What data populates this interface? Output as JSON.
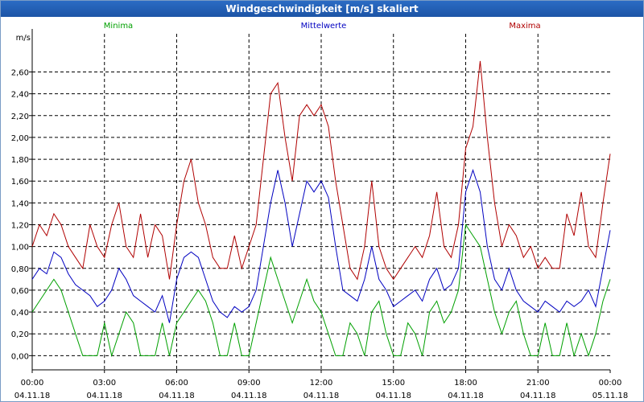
{
  "window": {
    "title": "Windgeschwindigkeit [m/s] skaliert"
  },
  "chart_data": {
    "type": "line",
    "title": "Windgeschwindigkeit [m/s] skaliert",
    "ylabel": "m/s",
    "xlabel": "",
    "ylim": [
      -0.13,
      2.95
    ],
    "xlim": [
      0,
      24
    ],
    "grid": true,
    "legend_position": "top",
    "y_ticks": [
      "0,00",
      "0,20",
      "0,40",
      "0,60",
      "0,80",
      "1,00",
      "1,20",
      "1,40",
      "1,60",
      "1,80",
      "2,00",
      "2,20",
      "2,40",
      "2,60"
    ],
    "x_ticks": [
      {
        "time": "00:00",
        "date": "04.11.18"
      },
      {
        "time": "03:00",
        "date": "04.11.18"
      },
      {
        "time": "06:00",
        "date": "04.11.18"
      },
      {
        "time": "09:00",
        "date": "04.11.18"
      },
      {
        "time": "12:00",
        "date": "04.11.18"
      },
      {
        "time": "15:00",
        "date": "04.11.18"
      },
      {
        "time": "18:00",
        "date": "04.11.18"
      },
      {
        "time": "21:00",
        "date": "04.11.18"
      },
      {
        "time": "00:00",
        "date": "05.11.18"
      }
    ],
    "series": [
      {
        "name": "Minima",
        "color": "#00a000",
        "points": [
          [
            0,
            0.4
          ],
          [
            0.3,
            0.5
          ],
          [
            0.6,
            0.6
          ],
          [
            0.9,
            0.7
          ],
          [
            1.2,
            0.6
          ],
          [
            1.5,
            0.4
          ],
          [
            1.8,
            0.2
          ],
          [
            2.1,
            0.0
          ],
          [
            2.4,
            0.0
          ],
          [
            2.7,
            0.0
          ],
          [
            3.0,
            0.3
          ],
          [
            3.3,
            0.0
          ],
          [
            3.6,
            0.2
          ],
          [
            3.9,
            0.4
          ],
          [
            4.2,
            0.3
          ],
          [
            4.5,
            0.0
          ],
          [
            4.8,
            0.0
          ],
          [
            5.1,
            0.0
          ],
          [
            5.4,
            0.3
          ],
          [
            5.7,
            0.0
          ],
          [
            6.0,
            0.3
          ],
          [
            6.3,
            0.4
          ],
          [
            6.6,
            0.5
          ],
          [
            6.9,
            0.6
          ],
          [
            7.2,
            0.5
          ],
          [
            7.5,
            0.3
          ],
          [
            7.8,
            0.0
          ],
          [
            8.1,
            0.0
          ],
          [
            8.4,
            0.3
          ],
          [
            8.7,
            0.0
          ],
          [
            9.0,
            0.0
          ],
          [
            9.3,
            0.3
          ],
          [
            9.6,
            0.6
          ],
          [
            9.9,
            0.9
          ],
          [
            10.2,
            0.7
          ],
          [
            10.5,
            0.5
          ],
          [
            10.8,
            0.3
          ],
          [
            11.1,
            0.5
          ],
          [
            11.4,
            0.7
          ],
          [
            11.7,
            0.5
          ],
          [
            12.0,
            0.4
          ],
          [
            12.3,
            0.2
          ],
          [
            12.6,
            0.0
          ],
          [
            12.9,
            0.0
          ],
          [
            13.2,
            0.3
          ],
          [
            13.5,
            0.2
          ],
          [
            13.8,
            0.0
          ],
          [
            14.1,
            0.4
          ],
          [
            14.4,
            0.5
          ],
          [
            14.7,
            0.2
          ],
          [
            15.0,
            0.0
          ],
          [
            15.3,
            0.0
          ],
          [
            15.6,
            0.3
          ],
          [
            15.9,
            0.2
          ],
          [
            16.2,
            0.0
          ],
          [
            16.5,
            0.4
          ],
          [
            16.8,
            0.5
          ],
          [
            17.1,
            0.3
          ],
          [
            17.4,
            0.4
          ],
          [
            17.7,
            0.6
          ],
          [
            18.0,
            1.2
          ],
          [
            18.3,
            1.1
          ],
          [
            18.6,
            1.0
          ],
          [
            18.9,
            0.7
          ],
          [
            19.2,
            0.4
          ],
          [
            19.5,
            0.2
          ],
          [
            19.8,
            0.4
          ],
          [
            20.1,
            0.5
          ],
          [
            20.4,
            0.2
          ],
          [
            20.7,
            0.0
          ],
          [
            21.0,
            0.0
          ],
          [
            21.3,
            0.3
          ],
          [
            21.6,
            0.0
          ],
          [
            21.9,
            0.0
          ],
          [
            22.2,
            0.3
          ],
          [
            22.5,
            0.0
          ],
          [
            22.8,
            0.2
          ],
          [
            23.1,
            0.0
          ],
          [
            23.4,
            0.2
          ],
          [
            23.7,
            0.5
          ],
          [
            24.0,
            0.7
          ]
        ]
      },
      {
        "name": "Mittelwerte",
        "color": "#0000c0",
        "points": [
          [
            0,
            0.7
          ],
          [
            0.3,
            0.8
          ],
          [
            0.6,
            0.75
          ],
          [
            0.9,
            0.95
          ],
          [
            1.2,
            0.9
          ],
          [
            1.5,
            0.75
          ],
          [
            1.8,
            0.65
          ],
          [
            2.1,
            0.6
          ],
          [
            2.4,
            0.55
          ],
          [
            2.7,
            0.45
          ],
          [
            3.0,
            0.5
          ],
          [
            3.3,
            0.6
          ],
          [
            3.6,
            0.8
          ],
          [
            3.9,
            0.7
          ],
          [
            4.2,
            0.55
          ],
          [
            4.5,
            0.5
          ],
          [
            4.8,
            0.45
          ],
          [
            5.1,
            0.4
          ],
          [
            5.4,
            0.55
          ],
          [
            5.7,
            0.3
          ],
          [
            6.0,
            0.7
          ],
          [
            6.3,
            0.9
          ],
          [
            6.6,
            0.95
          ],
          [
            6.9,
            0.9
          ],
          [
            7.2,
            0.7
          ],
          [
            7.5,
            0.5
          ],
          [
            7.8,
            0.4
          ],
          [
            8.1,
            0.35
          ],
          [
            8.4,
            0.45
          ],
          [
            8.7,
            0.4
          ],
          [
            9.0,
            0.45
          ],
          [
            9.3,
            0.6
          ],
          [
            9.6,
            1.0
          ],
          [
            9.9,
            1.4
          ],
          [
            10.2,
            1.7
          ],
          [
            10.5,
            1.4
          ],
          [
            10.8,
            1.0
          ],
          [
            11.1,
            1.3
          ],
          [
            11.4,
            1.6
          ],
          [
            11.7,
            1.5
          ],
          [
            12.0,
            1.6
          ],
          [
            12.3,
            1.45
          ],
          [
            12.6,
            1.0
          ],
          [
            12.9,
            0.6
          ],
          [
            13.2,
            0.55
          ],
          [
            13.5,
            0.5
          ],
          [
            13.8,
            0.7
          ],
          [
            14.1,
            1.0
          ],
          [
            14.4,
            0.7
          ],
          [
            14.7,
            0.6
          ],
          [
            15.0,
            0.45
          ],
          [
            15.3,
            0.5
          ],
          [
            15.6,
            0.55
          ],
          [
            15.9,
            0.6
          ],
          [
            16.2,
            0.5
          ],
          [
            16.5,
            0.7
          ],
          [
            16.8,
            0.8
          ],
          [
            17.1,
            0.6
          ],
          [
            17.4,
            0.65
          ],
          [
            17.7,
            0.8
          ],
          [
            18.0,
            1.5
          ],
          [
            18.3,
            1.7
          ],
          [
            18.6,
            1.5
          ],
          [
            18.9,
            1.0
          ],
          [
            19.2,
            0.7
          ],
          [
            19.5,
            0.6
          ],
          [
            19.8,
            0.8
          ],
          [
            20.1,
            0.6
          ],
          [
            20.4,
            0.5
          ],
          [
            20.7,
            0.45
          ],
          [
            21.0,
            0.4
          ],
          [
            21.3,
            0.5
          ],
          [
            21.6,
            0.45
          ],
          [
            21.9,
            0.4
          ],
          [
            22.2,
            0.5
          ],
          [
            22.5,
            0.45
          ],
          [
            22.8,
            0.5
          ],
          [
            23.1,
            0.6
          ],
          [
            23.4,
            0.45
          ],
          [
            23.7,
            0.8
          ],
          [
            24.0,
            1.15
          ]
        ]
      },
      {
        "name": "Maxima",
        "color": "#b00000",
        "points": [
          [
            0,
            1.0
          ],
          [
            0.3,
            1.2
          ],
          [
            0.6,
            1.1
          ],
          [
            0.9,
            1.3
          ],
          [
            1.2,
            1.2
          ],
          [
            1.5,
            1.0
          ],
          [
            1.8,
            0.9
          ],
          [
            2.1,
            0.8
          ],
          [
            2.4,
            1.2
          ],
          [
            2.7,
            1.0
          ],
          [
            3.0,
            0.9
          ],
          [
            3.3,
            1.2
          ],
          [
            3.6,
            1.4
          ],
          [
            3.9,
            1.0
          ],
          [
            4.2,
            0.9
          ],
          [
            4.5,
            1.3
          ],
          [
            4.8,
            0.9
          ],
          [
            5.1,
            1.2
          ],
          [
            5.4,
            1.1
          ],
          [
            5.7,
            0.7
          ],
          [
            6.0,
            1.2
          ],
          [
            6.3,
            1.6
          ],
          [
            6.6,
            1.8
          ],
          [
            6.9,
            1.4
          ],
          [
            7.2,
            1.2
          ],
          [
            7.5,
            0.9
          ],
          [
            7.8,
            0.8
          ],
          [
            8.1,
            0.8
          ],
          [
            8.4,
            1.1
          ],
          [
            8.7,
            0.8
          ],
          [
            9.0,
            1.0
          ],
          [
            9.3,
            1.2
          ],
          [
            9.6,
            1.8
          ],
          [
            9.9,
            2.4
          ],
          [
            10.2,
            2.5
          ],
          [
            10.5,
            2.0
          ],
          [
            10.8,
            1.6
          ],
          [
            11.1,
            2.2
          ],
          [
            11.4,
            2.3
          ],
          [
            11.7,
            2.2
          ],
          [
            12.0,
            2.3
          ],
          [
            12.3,
            2.1
          ],
          [
            12.6,
            1.6
          ],
          [
            12.9,
            1.2
          ],
          [
            13.2,
            0.8
          ],
          [
            13.5,
            0.7
          ],
          [
            13.8,
            1.0
          ],
          [
            14.1,
            1.6
          ],
          [
            14.4,
            1.0
          ],
          [
            14.7,
            0.8
          ],
          [
            15.0,
            0.7
          ],
          [
            15.3,
            0.8
          ],
          [
            15.6,
            0.9
          ],
          [
            15.9,
            1.0
          ],
          [
            16.2,
            0.9
          ],
          [
            16.5,
            1.1
          ],
          [
            16.8,
            1.5
          ],
          [
            17.1,
            1.0
          ],
          [
            17.4,
            0.9
          ],
          [
            17.7,
            1.2
          ],
          [
            18.0,
            1.9
          ],
          [
            18.3,
            2.1
          ],
          [
            18.6,
            2.7
          ],
          [
            18.9,
            2.0
          ],
          [
            19.2,
            1.4
          ],
          [
            19.5,
            1.0
          ],
          [
            19.8,
            1.2
          ],
          [
            20.1,
            1.1
          ],
          [
            20.4,
            0.9
          ],
          [
            20.7,
            1.0
          ],
          [
            21.0,
            0.8
          ],
          [
            21.3,
            0.9
          ],
          [
            21.6,
            0.8
          ],
          [
            21.9,
            0.8
          ],
          [
            22.2,
            1.3
          ],
          [
            22.5,
            1.1
          ],
          [
            22.8,
            1.5
          ],
          [
            23.1,
            1.0
          ],
          [
            23.4,
            0.9
          ],
          [
            23.7,
            1.4
          ],
          [
            24.0,
            1.85
          ]
        ]
      }
    ]
  }
}
